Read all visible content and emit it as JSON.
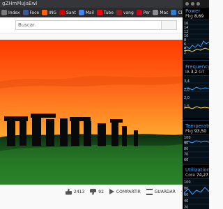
{
  "address": {
    "text": "gZHmMuJaEwI"
  },
  "bookmarks": [
    {
      "label": "Index",
      "color": "#7a7a7a"
    },
    {
      "label": "Face",
      "color": "#3b5998"
    },
    {
      "label": "ING",
      "color": "#ff6200"
    },
    {
      "label": "Sant",
      "color": "#d00000"
    },
    {
      "label": "Mail",
      "color": "#4285f4"
    },
    {
      "label": "Tube",
      "color": "#ff0000"
    },
    {
      "label": "vang",
      "color": "#9b1c1c"
    },
    {
      "label": "Per",
      "color": "#d0021b"
    },
    {
      "label": "Mac",
      "color": "#8d8d8d"
    },
    {
      "label": "Clickl",
      "color": "#2d7dd2"
    }
  ],
  "search": {
    "placeholder": "Buscar"
  },
  "actions": {
    "likes": "2413",
    "dislikes": "92",
    "share": "COMPARTIR",
    "save": "GUARDAR",
    "more": "···"
  },
  "monitor": {
    "power": {
      "title": "Power",
      "label": "Pkg",
      "value": "8,69",
      "ticks": [
        "16",
        "14",
        "12",
        "10",
        "8",
        "6",
        "4",
        "2"
      ]
    },
    "frequency": {
      "title": "Frequency",
      "label": "IA",
      "value": "3,2",
      "label2": "GT",
      "ticks": [
        "3,4",
        "2,8",
        "2,0",
        "1,5"
      ]
    },
    "temperature": {
      "title": "Temperature",
      "label": "Pkg",
      "value": "93,50",
      "ticks": [
        "100",
        "90",
        "80",
        "70",
        "60"
      ]
    },
    "utilization": {
      "title": "Utilization",
      "label": "Core",
      "value": "74,27",
      "ticks": [
        "100",
        "80",
        "60",
        "40",
        "20"
      ]
    }
  },
  "colors": {
    "accent": "#4aa3ff",
    "chart_line": "#38a0ff",
    "sunset_top": "#ff7a1a",
    "sunset_bottom": "#ffd23a"
  }
}
